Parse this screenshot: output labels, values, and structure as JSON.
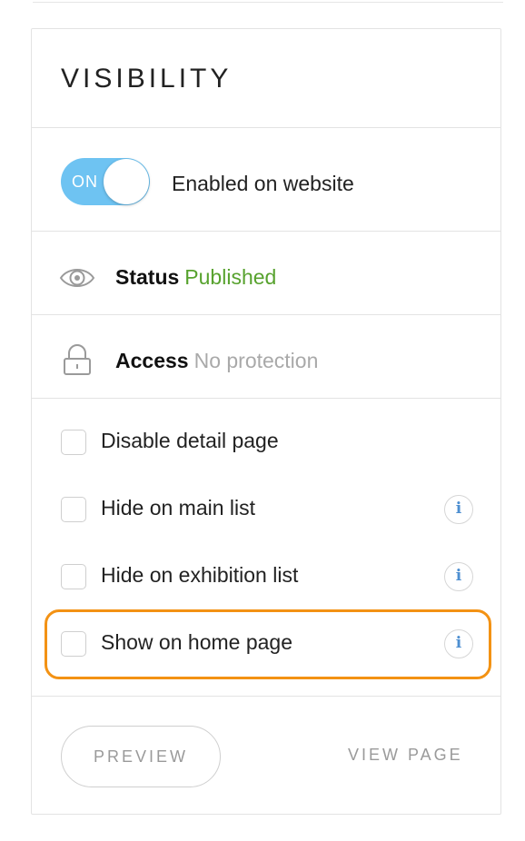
{
  "panel": {
    "title": "VISIBILITY"
  },
  "toggle": {
    "state_label": "ON",
    "description": "Enabled on website",
    "on": true,
    "color": "#6ec3f2"
  },
  "status": {
    "icon": "eye-icon",
    "label": "Status",
    "value": "Published",
    "value_color": "#57a22e"
  },
  "access": {
    "icon": "lock-icon",
    "label": "Access",
    "value": "No protection"
  },
  "options": [
    {
      "label": "Disable detail page",
      "checked": false,
      "has_info": false
    },
    {
      "label": "Hide on main list",
      "checked": false,
      "has_info": true,
      "info_glyph": "i"
    },
    {
      "label": "Hide on exhibition list",
      "checked": false,
      "has_info": true,
      "info_glyph": "i"
    },
    {
      "label": "Show on home page",
      "checked": false,
      "has_info": true,
      "info_glyph": "i",
      "highlighted": true
    }
  ],
  "highlight_color": "#f39214",
  "actions": {
    "preview_label": "PREVIEW",
    "view_page_label": "VIEW PAGE"
  }
}
